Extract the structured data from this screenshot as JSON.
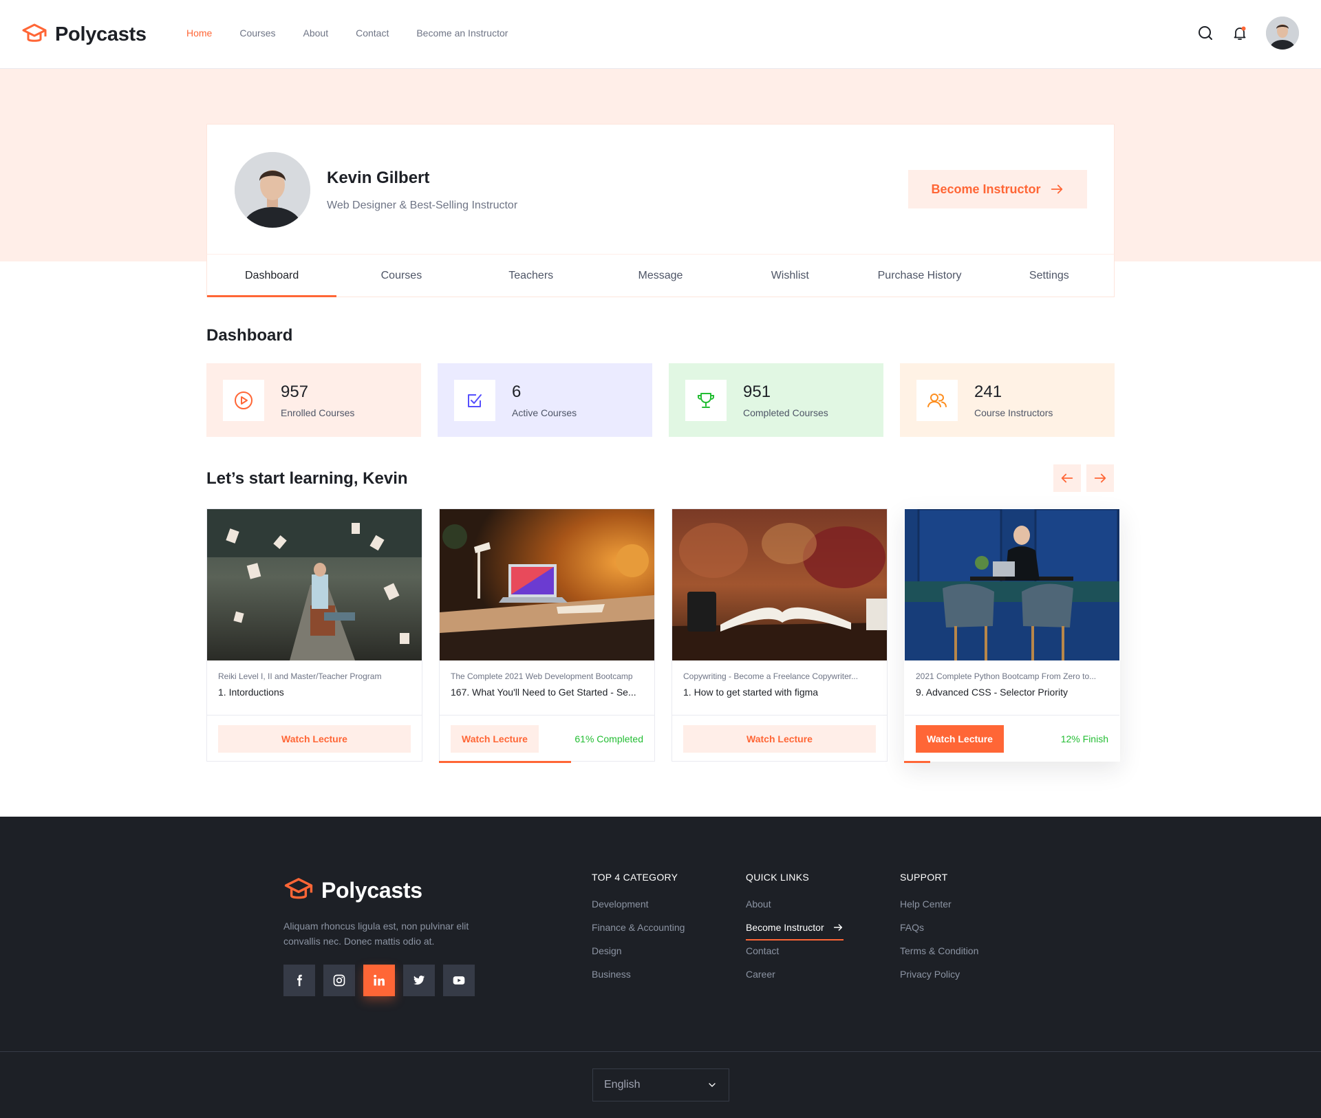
{
  "brand": {
    "name": "Polycasts",
    "accent": "#ff6636"
  },
  "header": {
    "nav": [
      {
        "label": "Home",
        "active": true
      },
      {
        "label": "Courses",
        "active": false
      },
      {
        "label": "About",
        "active": false
      },
      {
        "label": "Contact",
        "active": false
      },
      {
        "label": "Become an Instructor",
        "active": false
      }
    ],
    "icons": [
      "search-icon",
      "bell-icon",
      "avatar"
    ]
  },
  "profile": {
    "name": "Kevin Gilbert",
    "title": "Web Designer & Best-Selling Instructor",
    "cta_label": "Become Instructor"
  },
  "tabs": [
    {
      "label": "Dashboard",
      "active": true
    },
    {
      "label": "Courses",
      "active": false
    },
    {
      "label": "Teachers",
      "active": false
    },
    {
      "label": "Message",
      "active": false
    },
    {
      "label": "Wishlist",
      "active": false
    },
    {
      "label": "Purchase History",
      "active": false
    },
    {
      "label": "Settings",
      "active": false
    }
  ],
  "dashboard": {
    "title": "Dashboard",
    "stats": [
      {
        "value": "957",
        "label": "Enrolled Courses",
        "icon": "play-circle-icon",
        "bg": "#ffeee8",
        "color": "#ff6636"
      },
      {
        "value": "6",
        "label": "Active Courses",
        "icon": "check-square-icon",
        "bg": "#ebebff",
        "color": "#564ffd"
      },
      {
        "value": "951",
        "label": "Completed Courses",
        "icon": "trophy-icon",
        "bg": "#e1f7e3",
        "color": "#23bd33"
      },
      {
        "value": "241",
        "label": "Course Instructors",
        "icon": "users-icon",
        "bg": "#fff2e5",
        "color": "#fd8e1f"
      }
    ]
  },
  "learning": {
    "title": "Let’s start learning, Kevin",
    "cards": [
      {
        "course": "Reiki Level I, II and Master/Teacher Program",
        "lecture": "1. Intorductions",
        "button": "Watch Lecture",
        "progress_text": "",
        "progress": 0
      },
      {
        "course": "The Complete 2021 Web Development Bootcamp",
        "lecture": "167. What You'll Need to Get Started - Se...",
        "button": "Watch Lecture",
        "progress_text": "61% Completed",
        "progress": 0.61
      },
      {
        "course": "Copywriting - Become a Freelance Copywriter...",
        "lecture": "1. How to get started with figma",
        "button": "Watch Lecture",
        "progress_text": "",
        "progress": 0
      },
      {
        "course": "2021 Complete Python Bootcamp From Zero to...",
        "lecture": "9. Advanced CSS - Selector Priority",
        "button": "Watch Lecture",
        "progress_text": "12% Finish",
        "progress": 0.12
      }
    ]
  },
  "footer": {
    "brand": "Polycasts",
    "description": "Aliquam rhoncus ligula est, non pulvinar elit convallis nec. Donec mattis odio at.",
    "socials": [
      "facebook-icon",
      "instagram-icon",
      "linkedin-icon",
      "twitter-icon",
      "youtube-icon"
    ],
    "columns": [
      {
        "title": "TOP 4 CATEGORY",
        "links": [
          "Development",
          "Finance & Accounting",
          "Design",
          "Business"
        ]
      },
      {
        "title": "QUICK LINKS",
        "links": [
          "About",
          "Become Instructor",
          "Contact",
          "Career"
        ]
      },
      {
        "title": "SUPPORT",
        "links": [
          "Help Center",
          "FAQs",
          "Terms & Condition",
          "Privacy Policy"
        ]
      }
    ],
    "language": "English"
  }
}
